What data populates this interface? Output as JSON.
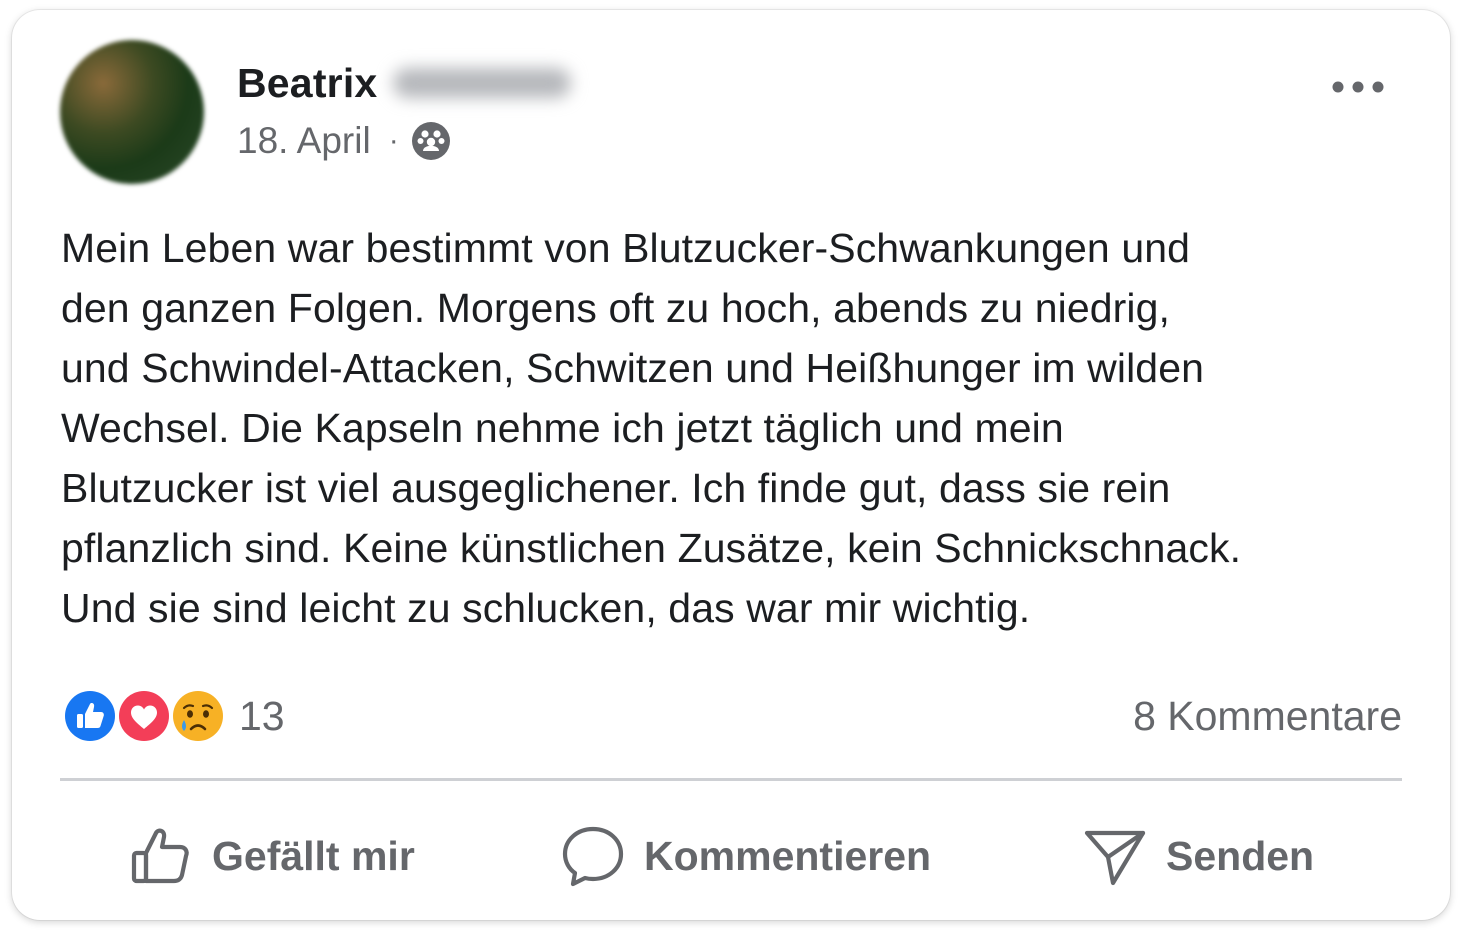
{
  "post": {
    "author_first_name": "Beatrix",
    "date": "18. April",
    "separator": "·",
    "audience_icon": "friends-icon",
    "text_lines": [
      "Mein Leben war bestimmt von Blutzucker-Schwankungen und",
      "den ganzen Folgen. Morgens oft zu hoch, abends zu niedrig,",
      "und Schwindel-Attacken, Schwitzen und Heißhunger im wilden",
      "Wechsel. Die Kapseln nehme ich jetzt täglich und mein",
      "Blutzucker ist viel ausgeglichener. Ich finde gut, dass sie rein",
      "pflanzlich sind. Keine künstlichen Zusätze, kein Schnickschnack.",
      "Und sie sind leicht zu schlucken, das war mir wichtig."
    ]
  },
  "reactions": {
    "types": [
      "like",
      "love",
      "sad"
    ],
    "count": "13"
  },
  "comments": {
    "label": "8 Kommentare"
  },
  "actions": {
    "like_label": "Gefällt mir",
    "comment_label": "Kommentieren",
    "send_label": "Senden"
  },
  "colors": {
    "text_primary": "#1c1e21",
    "text_secondary": "#65676b",
    "like_blue": "#1877f2",
    "love_red": "#f33e58",
    "sad_yellow": "#f7b125",
    "divider": "#ced0d4"
  }
}
